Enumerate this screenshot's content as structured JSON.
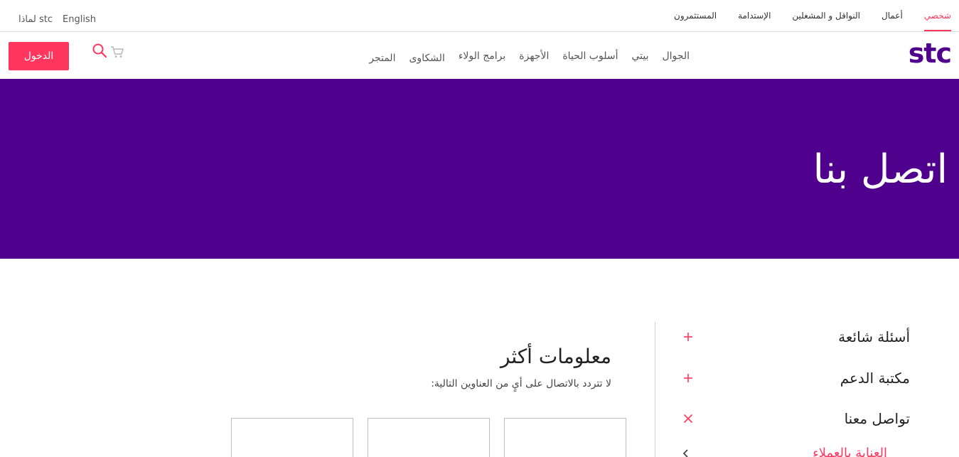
{
  "topbar": {
    "segments": [
      "شخصي",
      "أعمال",
      "النواقل و المشغلين",
      "الإستدامة",
      "المستثمرون"
    ],
    "active_segment": "شخصي",
    "language": "English",
    "why_stc": "لماذا stc"
  },
  "brand": {
    "logo_text": "stc",
    "color": "#4f008c",
    "accent": "#ff375e"
  },
  "nav": {
    "items": [
      "الجوال",
      "بيتي",
      "أسلوب الحياة",
      "الأجهزة",
      "برامج الولاء",
      "الشكاوى",
      "المتجر"
    ],
    "login_label": "الدخول",
    "icons": [
      "search-icon",
      "cart-icon"
    ]
  },
  "hero": {
    "title": "اتصل بنا",
    "background": "#4f008c"
  },
  "accordion": {
    "items": [
      {
        "label": "أسئلة شائعة",
        "state": "collapsed"
      },
      {
        "label": "مكتبة الدعم",
        "state": "collapsed"
      },
      {
        "label": "تواصل معنا",
        "state": "expanded"
      }
    ],
    "subitem": "العناية بالعملاء"
  },
  "info": {
    "title": "معلومات أكثر",
    "subtitle": "لا تتردد بالاتصال على أيٍ من العناوين التالية:"
  }
}
